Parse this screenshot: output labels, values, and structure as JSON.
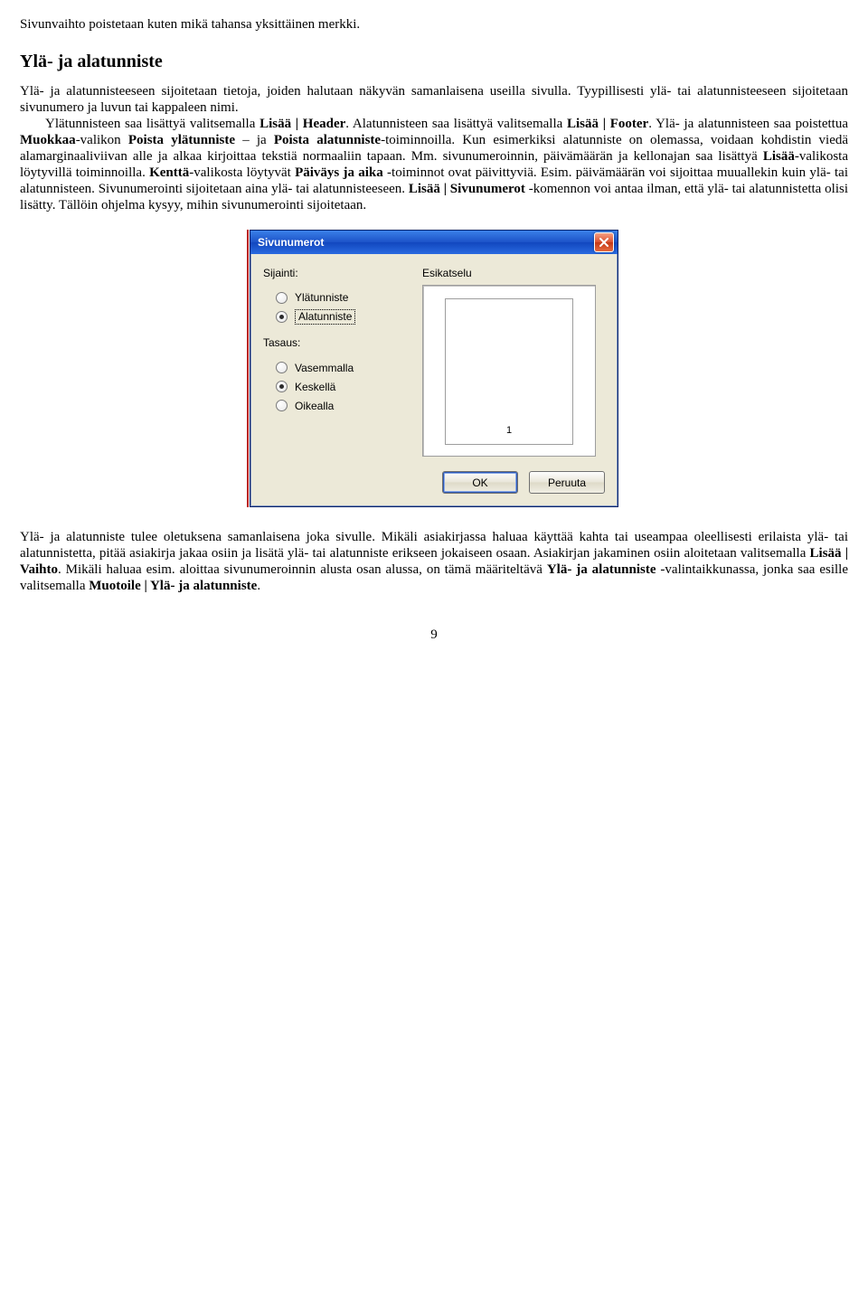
{
  "intro_para": "Sivunvaihto poistetaan kuten mikä tahansa yksittäinen merkki.",
  "section_title": "Ylä- ja alatunniste",
  "para1_pre": "Ylä- ja alatunnisteeseen sijoitetaan tietoja, joiden halutaan näkyvän samanlaisena useilla sivulla. Tyypillisesti ylä- tai alatunnisteeseen sijoitetaan sivunumero ja luvun tai kappaleen nimi.",
  "para1_indent": "Ylätunnisteen saa lisättyä valitsemalla ",
  "bold1": "Lisää | Header",
  "para1_mid": ". Alatunnisteen saa lisättyä valitsemalla ",
  "bold2": "Lisää | Footer",
  "para1_after": ". Ylä- ja alatunnisteen saa poistettua ",
  "bold3": "Muokkaa",
  "para1_after2": "-valikon ",
  "bold4": "Poista ylätunniste",
  "para1_dash": " – ja ",
  "bold5": "Poista alatunniste",
  "para1_tail": "-toiminnoilla. Kun esimerkiksi alatunniste on olemassa, voidaan kohdistin viedä alamarginaaliviivan alle ja alkaa kirjoittaa tekstiä normaaliin tapaan. Mm. sivunumeroinnin, päivämäärän ja kellonajan saa lisättyä ",
  "bold6": "Lisää",
  "para1_tail2": "-valikosta löytyvillä toiminnoilla. ",
  "bold7": "Kenttä",
  "para1_tail3": "-valikosta löytyvät ",
  "bold8": "Päiväys ja aika",
  "para1_tail4": " -toiminnot ovat päivittyviä. Esim. päivämäärän voi sijoittaa muuallekin kuin ylä- tai alatunnisteen. Sivunumerointi sijoitetaan aina ylä- tai alatunnisteeseen. ",
  "bold9": "Lisää | Sivunumerot",
  "para1_tail5": " -komennon voi antaa ilman, että ylä- tai alatunnistetta olisi lisätty. Tällöin ohjelma kysyy, mihin sivunumerointi sijoitetaan.",
  "dialog": {
    "title": "Sivunumerot",
    "sijainti_label": "Sijainti:",
    "opt_yla": "Ylätunniste",
    "opt_ala": "Alatunniste",
    "tasaus_label": "Tasaus:",
    "opt_vas": "Vasemmalla",
    "opt_kes": "Keskellä",
    "opt_oik": "Oikealla",
    "esikatselu": "Esikatselu",
    "preview_num": "1",
    "ok": "OK",
    "cancel": "Peruuta"
  },
  "para2_a": "Ylä- ja alatunniste tulee oletuksena samanlaisena joka sivulle. Mikäli asiakirjassa haluaa käyttää kahta tai useampaa oleellisesti erilaista ylä- tai alatunnistetta, pitää asiakirja jakaa osiin ja lisätä ylä- tai alatunniste erikseen jokaiseen osaan. Asiakirjan jakaminen osiin aloitetaan valitsemalla ",
  "bold10": "Lisää | Vaihto",
  "para2_b": ". Mikäli haluaa esim. aloittaa sivunumeroinnin alusta osan alussa, on tämä määriteltävä ",
  "bold11": "Ylä- ja alatunniste",
  "para2_c": " -valintaikkunassa, jonka saa esille valitsemalla ",
  "bold12": "Muotoile | Ylä- ja alatunniste",
  "para2_d": ".",
  "page_number": "9"
}
